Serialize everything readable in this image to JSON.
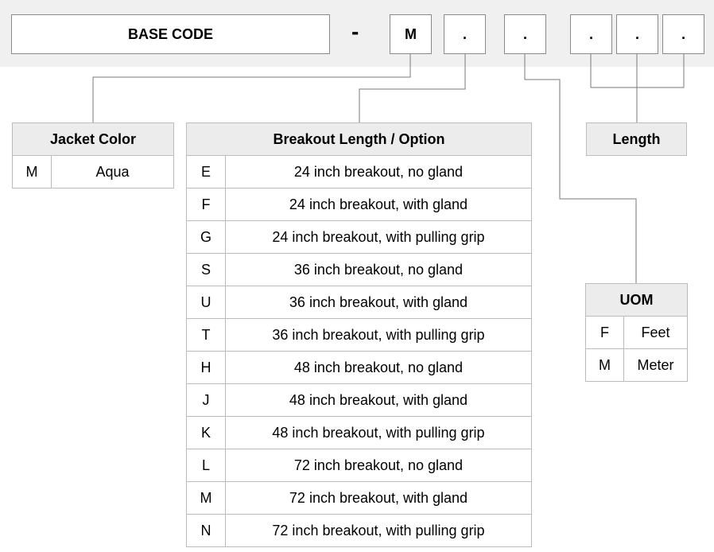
{
  "header": {
    "base_code": "BASE CODE",
    "dash": "-",
    "segments": [
      "M",
      ".",
      ".",
      ".",
      ".",
      "."
    ]
  },
  "jacket_color": {
    "title": "Jacket Color",
    "rows": [
      {
        "code": "M",
        "desc": "Aqua"
      }
    ]
  },
  "breakout": {
    "title": "Breakout Length / Option",
    "rows": [
      {
        "code": "E",
        "desc": "24 inch breakout, no gland"
      },
      {
        "code": "F",
        "desc": "24 inch breakout, with gland"
      },
      {
        "code": "G",
        "desc": "24 inch breakout, with pulling grip"
      },
      {
        "code": "S",
        "desc": "36 inch breakout, no gland"
      },
      {
        "code": "U",
        "desc": "36 inch breakout, with gland"
      },
      {
        "code": "T",
        "desc": "36 inch breakout, with pulling grip"
      },
      {
        "code": "H",
        "desc": "48 inch breakout, no gland"
      },
      {
        "code": "J",
        "desc": "48 inch breakout, with gland"
      },
      {
        "code": "K",
        "desc": "48 inch breakout, with pulling grip"
      },
      {
        "code": "L",
        "desc": "72 inch breakout, no gland"
      },
      {
        "code": "M",
        "desc": "72 inch breakout, with gland"
      },
      {
        "code": "N",
        "desc": "72 inch breakout, with pulling grip"
      }
    ]
  },
  "length": {
    "title": "Length"
  },
  "uom": {
    "title": "UOM",
    "rows": [
      {
        "code": "F",
        "desc": "Feet"
      },
      {
        "code": "M",
        "desc": "Meter"
      }
    ]
  }
}
